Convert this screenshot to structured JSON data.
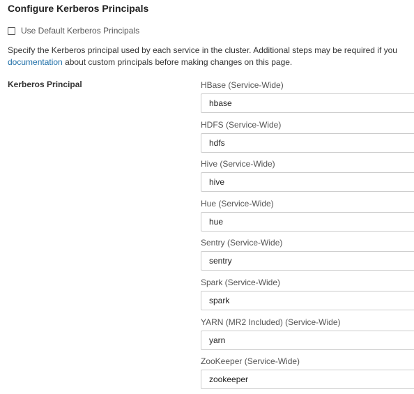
{
  "title": "Configure Kerberos Principals",
  "default_checkbox": {
    "label": "Use Default Kerberos Principals",
    "checked": false
  },
  "description": {
    "line1": "Specify the Kerberos principal used by each service in the cluster. Additional steps may be required if you",
    "link": "documentation",
    "line2_rest": " about custom principals before making changes on this page."
  },
  "section_label": "Kerberos Principal",
  "fields": [
    {
      "label": "HBase (Service-Wide)",
      "value": "hbase"
    },
    {
      "label": "HDFS (Service-Wide)",
      "value": "hdfs"
    },
    {
      "label": "Hive (Service-Wide)",
      "value": "hive"
    },
    {
      "label": "Hue (Service-Wide)",
      "value": "hue"
    },
    {
      "label": "Sentry (Service-Wide)",
      "value": "sentry"
    },
    {
      "label": "Spark (Service-Wide)",
      "value": "spark"
    },
    {
      "label": "YARN (MR2 Included) (Service-Wide)",
      "value": "yarn"
    },
    {
      "label": "ZooKeeper (Service-Wide)",
      "value": "zookeeper"
    }
  ]
}
